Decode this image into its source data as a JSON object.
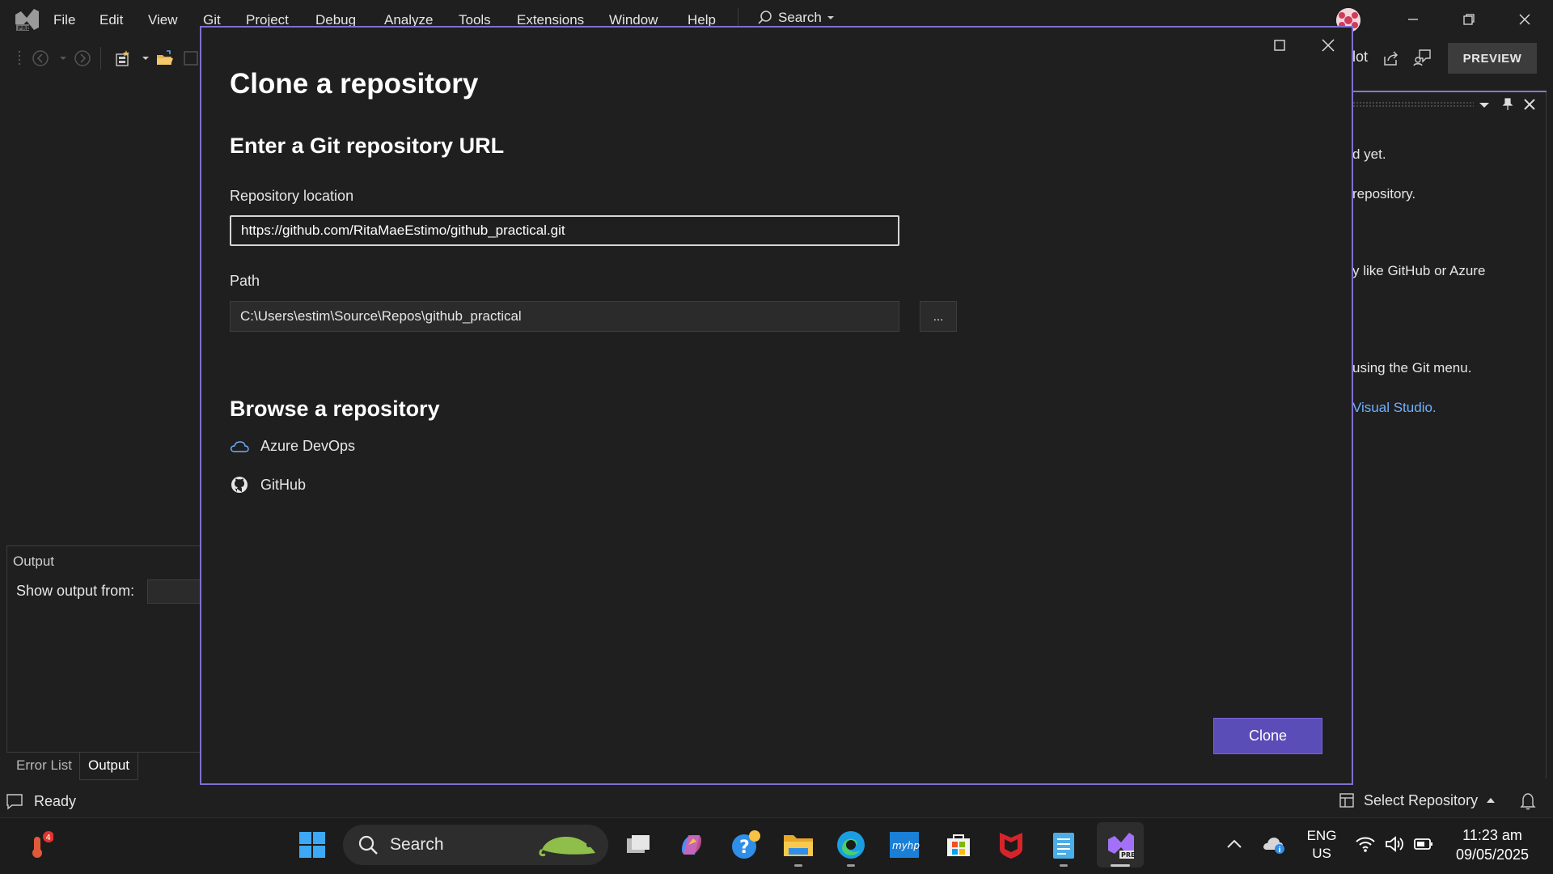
{
  "menubar": {
    "items": [
      "File",
      "Edit",
      "View",
      "Git",
      "Project",
      "Debug",
      "Analyze",
      "Tools",
      "Extensions",
      "Window",
      "Help"
    ],
    "search_label": "Search"
  },
  "toolbar": {
    "copilot_partial": "lot",
    "preview_label": "PREVIEW"
  },
  "right_panel": {
    "lines": [
      "d yet.",
      "repository.",
      "y like GitHub or Azure",
      "using the Git menu."
    ],
    "link_text": "Visual Studio."
  },
  "output": {
    "title": "Output",
    "show_output_from": "Show output from:",
    "tabs": [
      "Error List",
      "Output"
    ]
  },
  "status": {
    "ready": "Ready",
    "select_repository": "Select Repository"
  },
  "dialog": {
    "title": "Clone a repository",
    "url_heading": "Enter a Git repository URL",
    "repo_location_label": "Repository location",
    "repo_location_value": "https://github.com/RitaMaeEstimo/github_practical.git",
    "path_label": "Path",
    "path_value": "C:\\Users\\estim\\Source\\Repos\\github_practical",
    "browse_label": "...",
    "browse_heading": "Browse a repository",
    "providers": [
      "Azure DevOps",
      "GitHub"
    ],
    "clone_label": "Clone"
  },
  "taskbar": {
    "search_label": "Search",
    "notification_count": "4",
    "lang_line1": "ENG",
    "lang_line2": "US",
    "time": "11:23 am",
    "date": "09/05/2025"
  },
  "colors": {
    "accent": "#7f6fd0",
    "clone_button": "#5b4db8",
    "link": "#6fb1ff",
    "background": "#1f1f1f"
  }
}
